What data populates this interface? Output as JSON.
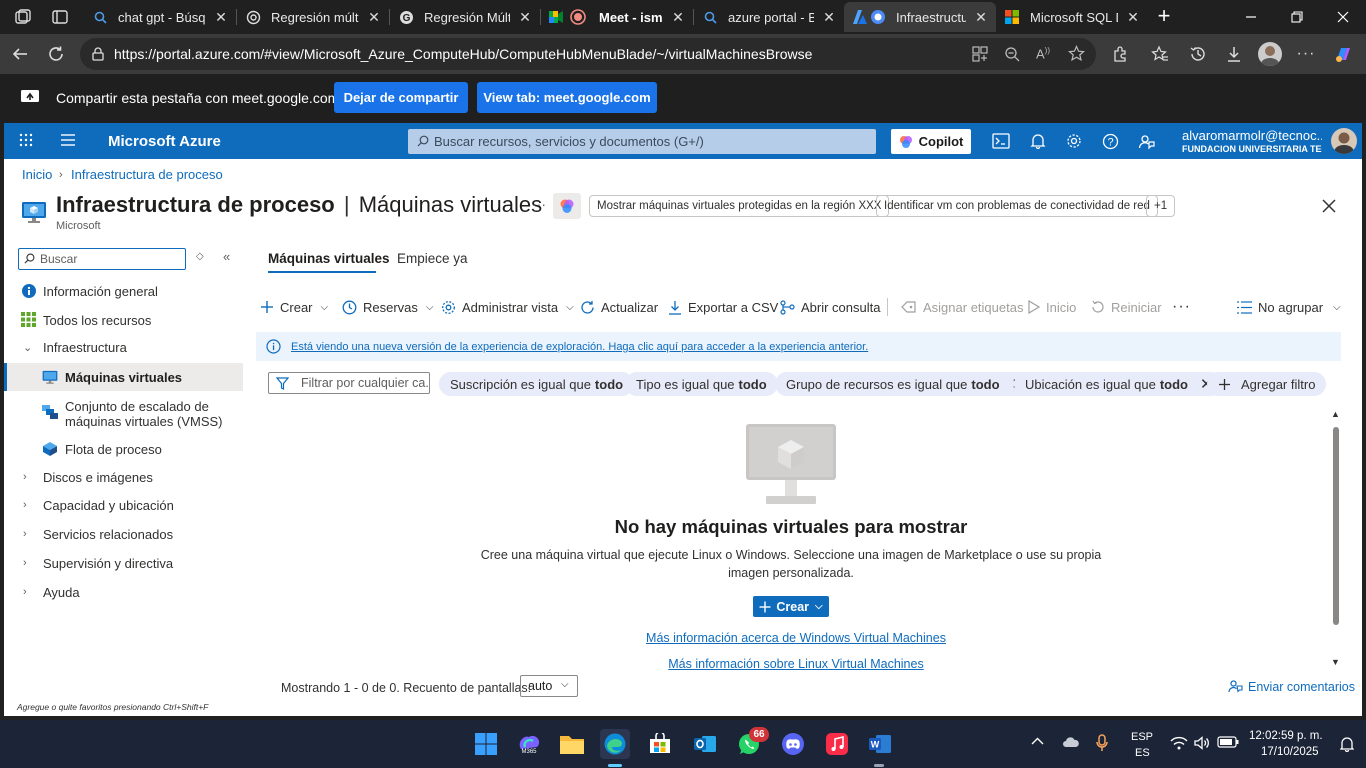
{
  "browser": {
    "tabs": [
      {
        "title": "chat gpt - Búsqu",
        "favicon": "search-icon"
      },
      {
        "title": "Regresión múltip",
        "favicon": "chatgpt-icon"
      },
      {
        "title": "Regresión Múltip",
        "favicon": "google-g-icon"
      },
      {
        "title": "Meet - ism-q",
        "favicon": "meet-icon"
      },
      {
        "title": "azure portal - Bú",
        "favicon": "search-icon"
      },
      {
        "title": "Infraestructu",
        "favicon": "azure-icon"
      },
      {
        "title": "Microsoft SQL D",
        "favicon": "microsoft-icon"
      }
    ],
    "url": "https://portal.azure.com/#view/Microsoft_Azure_ComputeHub/ComputeHubMenuBlade/~/virtualMachinesBrowse"
  },
  "sharebar": {
    "text": "Compartir esta pestaña con meet.google.com",
    "stop_label": "Dejar de compartir",
    "view_label": "View tab: meet.google.com"
  },
  "azure": {
    "brand": "Microsoft Azure",
    "search_placeholder": "Buscar recursos, servicios y documentos (G+/)",
    "copilot_label": "Copilot",
    "user_name": "alvaromarmolr@tecnoc...",
    "user_org": "FUNDACION UNIVERSITARIA TEC..."
  },
  "breadcrumb": {
    "home": "Inicio",
    "current": "Infraestructura de proceso"
  },
  "page": {
    "title": "Infraestructura de proceso",
    "subtitle_sep": "|",
    "subtitle": "Máquinas virtuales",
    "publisher": "Microsoft",
    "more": "···",
    "suggestions": [
      "Mostrar máquinas virtuales protegidas en la región XXX",
      "Identificar vm con problemas de conectividad de red"
    ],
    "suggestions_more": "+1"
  },
  "sidebar": {
    "search_placeholder": "Buscar",
    "items": [
      {
        "label": "Información general"
      },
      {
        "label": "Todos los recursos"
      },
      {
        "label": "Infraestructura"
      },
      {
        "label": "Máquinas virtuales"
      },
      {
        "label": "Conjunto de escalado de máquinas virtuales (VMSS)"
      },
      {
        "label": "Flota de proceso"
      },
      {
        "label": "Discos e imágenes"
      },
      {
        "label": "Capacidad y ubicación"
      },
      {
        "label": "Servicios relacionados"
      },
      {
        "label": "Supervisión y directiva"
      },
      {
        "label": "Ayuda"
      }
    ],
    "footer_hint": "Agregue o quite favoritos presionando Ctrl+Shift+F"
  },
  "tabs": [
    "Máquinas virtuales",
    "Empiece ya"
  ],
  "toolbar": {
    "create": "Crear",
    "reservations": "Reservas",
    "manage_view": "Administrar vista",
    "refresh": "Actualizar",
    "export": "Exportar a CSV",
    "open_query": "Abrir consulta",
    "assign_tags": "Asignar etiquetas",
    "start": "Inicio",
    "restart": "Reiniciar",
    "more": "···",
    "group_by": "No agrupar"
  },
  "info_banner": "Está viendo una nueva versión de la experiencia de exploración. Haga clic aquí para acceder a la experiencia anterior.",
  "filters": {
    "placeholder": "Filtrar por cualquier ca...",
    "pills": [
      {
        "label": "Suscripción es igual que",
        "value": "todo"
      },
      {
        "label": "Tipo es igual que",
        "value": "todo"
      },
      {
        "label": "Grupo de recursos es igual que",
        "value": "todo"
      },
      {
        "label": "Ubicación es igual que",
        "value": "todo"
      }
    ],
    "add_filter": "Agregar filtro"
  },
  "empty_state": {
    "title": "No hay máquinas virtuales para mostrar",
    "line1": "Cree una máquina virtual que ejecute Linux o Windows. Seleccione una imagen de Marketplace o use su propia",
    "line2": "imagen personalizada.",
    "create_label": "Crear",
    "link_windows": "Más información acerca de Windows Virtual Machines",
    "link_linux": "Más información sobre Linux Virtual Machines"
  },
  "footer": {
    "showing": "Mostrando 1 - 0 de 0. Recuento de pantallas:",
    "page_count_value": "auto",
    "feedback": "Enviar comentarios"
  },
  "taskbar": {
    "whatsapp_badge": "66",
    "lang_top": "ESP",
    "lang_bottom": "ES",
    "time": "12:02:59 p. m.",
    "date": "17/10/2025",
    "m365_label": "M365"
  },
  "colors": {
    "azure_blue": "#0f6cbd",
    "meet_blue": "#1a73e8",
    "pill_bg": "#e8ebf9"
  }
}
